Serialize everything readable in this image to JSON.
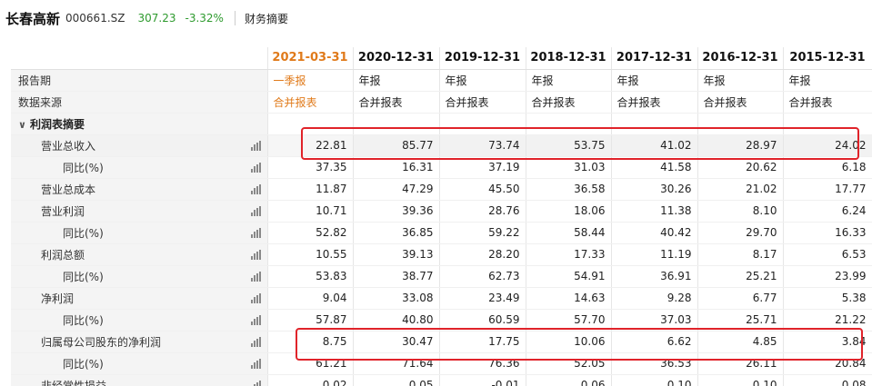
{
  "header": {
    "stock_name": "长春高新",
    "stock_code": "000661.SZ",
    "price": "307.23",
    "change": "-3.32%",
    "section": "财务摘要"
  },
  "columns": [
    "2021-03-31",
    "2020-12-31",
    "2019-12-31",
    "2018-12-31",
    "2017-12-31",
    "2016-12-31",
    "2015-12-31"
  ],
  "rows": [
    {
      "label": "报告期",
      "level": 0,
      "values": [
        "一季报",
        "年报",
        "年报",
        "年报",
        "年报",
        "年报",
        "年报"
      ],
      "kind": "txt",
      "chart": false
    },
    {
      "label": "数据来源",
      "level": 0,
      "values": [
        "合并报表",
        "合并报表",
        "合并报表",
        "合并报表",
        "合并报表",
        "合并报表",
        "合并报表"
      ],
      "kind": "txt",
      "chart": false
    },
    {
      "label": "利润表摘要",
      "level": 0,
      "values": [
        "",
        "",
        "",
        "",
        "",
        "",
        ""
      ],
      "kind": "section",
      "chart": false
    },
    {
      "label": "营业总收入",
      "level": 1,
      "values": [
        "22.81",
        "85.77",
        "73.74",
        "53.75",
        "41.02",
        "28.97",
        "24.02"
      ],
      "kind": "num",
      "chart": true,
      "shade": true
    },
    {
      "label": "同比(%)",
      "level": 2,
      "values": [
        "37.35",
        "16.31",
        "37.19",
        "31.03",
        "41.58",
        "20.62",
        "6.18"
      ],
      "kind": "num",
      "chart": true
    },
    {
      "label": "营业总成本",
      "level": 1,
      "values": [
        "11.87",
        "47.29",
        "45.50",
        "36.58",
        "30.26",
        "21.02",
        "17.77"
      ],
      "kind": "num",
      "chart": true
    },
    {
      "label": "营业利润",
      "level": 1,
      "values": [
        "10.71",
        "39.36",
        "28.76",
        "18.06",
        "11.38",
        "8.10",
        "6.24"
      ],
      "kind": "num",
      "chart": true
    },
    {
      "label": "同比(%)",
      "level": 2,
      "values": [
        "52.82",
        "36.85",
        "59.22",
        "58.44",
        "40.42",
        "29.70",
        "16.33"
      ],
      "kind": "num",
      "chart": true
    },
    {
      "label": "利润总额",
      "level": 1,
      "values": [
        "10.55",
        "39.13",
        "28.20",
        "17.33",
        "11.19",
        "8.17",
        "6.53"
      ],
      "kind": "num",
      "chart": true
    },
    {
      "label": "同比(%)",
      "level": 2,
      "values": [
        "53.83",
        "38.77",
        "62.73",
        "54.91",
        "36.91",
        "25.21",
        "23.99"
      ],
      "kind": "num",
      "chart": true
    },
    {
      "label": "净利润",
      "level": 1,
      "values": [
        "9.04",
        "33.08",
        "23.49",
        "14.63",
        "9.28",
        "6.77",
        "5.38"
      ],
      "kind": "num",
      "chart": true
    },
    {
      "label": "同比(%)",
      "level": 2,
      "values": [
        "57.87",
        "40.80",
        "60.59",
        "57.70",
        "37.03",
        "25.71",
        "21.22"
      ],
      "kind": "num",
      "chart": true
    },
    {
      "label": "归属母公司股东的净利润",
      "level": 1,
      "values": [
        "8.75",
        "30.47",
        "17.75",
        "10.06",
        "6.62",
        "4.85",
        "3.84"
      ],
      "kind": "num",
      "chart": true
    },
    {
      "label": "同比(%)",
      "level": 2,
      "values": [
        "61.21",
        "71.64",
        "76.36",
        "52.05",
        "36.53",
        "26.11",
        "20.84"
      ],
      "kind": "num",
      "chart": true
    },
    {
      "label": "非经常性损益",
      "level": 1,
      "values": [
        "0.02",
        "0.05",
        "-0.01",
        "0.06",
        "0.10",
        "0.10",
        "0.08"
      ],
      "kind": "num",
      "chart": true
    }
  ],
  "colors": {
    "accent": "#e07a1a",
    "down": "#2e9a2e",
    "highlight": "#e0232a"
  }
}
